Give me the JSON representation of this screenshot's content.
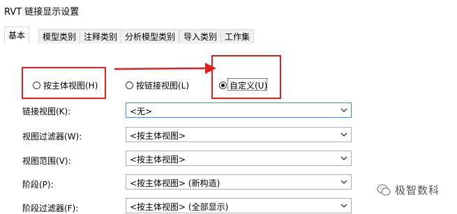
{
  "window": {
    "title": "RVT 链接显示设置"
  },
  "tabs": [
    {
      "label": "基本"
    },
    {
      "label": "模型类别"
    },
    {
      "label": "注释类别"
    },
    {
      "label": "分析模型类别"
    },
    {
      "label": "导入类别"
    },
    {
      "label": "工作集"
    }
  ],
  "radios": [
    {
      "label": "按主体视图(H)",
      "checked": false
    },
    {
      "label": "按链接视图(L)",
      "checked": false
    },
    {
      "label": "自定义(U)",
      "checked": true
    }
  ],
  "fields": [
    {
      "label": "链接视图(K):",
      "value": "<无>"
    },
    {
      "label": "视图过滤器(W):",
      "value": "<按主体视图>"
    },
    {
      "label": "视图范围(V):",
      "value": "<按主体视图>"
    },
    {
      "label": "阶段(P):",
      "value": "<按主体视图> (新构造)"
    },
    {
      "label": "阶段过滤器(F):",
      "value": "<按主体视图> (全部显示)"
    }
  ],
  "annotation": {
    "color": "#e02020"
  },
  "watermark": {
    "text": "极智数科",
    "icon": "wechat-icon"
  }
}
